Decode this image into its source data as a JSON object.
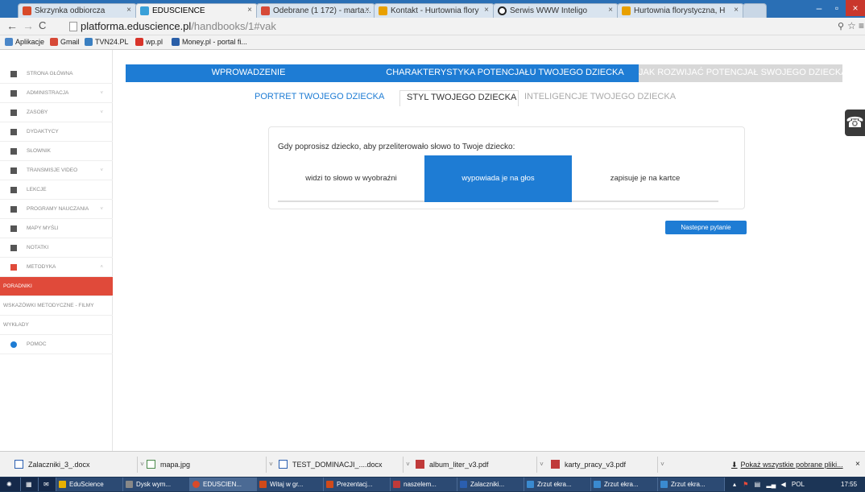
{
  "browser": {
    "tabs": [
      {
        "label": "Skrzynka odbiorcza",
        "color": "#d84a2a"
      },
      {
        "label": "EDUSCIENCE",
        "color": "#3aa0d8"
      },
      {
        "label": "Odebrane (1 172) - marta...",
        "color": "#d64937"
      },
      {
        "label": "Kontakt - Hurtownia flory",
        "color": "#e8a000"
      },
      {
        "label": "Serwis WWW Inteligo",
        "color": "#222222"
      },
      {
        "label": "Hurtownia florystyczna, H",
        "color": "#e8a000"
      }
    ],
    "active_tab_index": 1,
    "url_host": "platforma.eduscience.pl",
    "url_path": "/handbooks/1#vak",
    "bookmarks": [
      {
        "label": "Aplikacje",
        "color": "#4a86c8"
      },
      {
        "label": "Gmail",
        "color": "#d64937"
      },
      {
        "label": "TVN24.PL",
        "color": "#3a7fc1"
      },
      {
        "label": "wp.pl",
        "color": "#d8342a"
      },
      {
        "label": "Money.pl - portal fi...",
        "color": "#2a5fa8"
      }
    ]
  },
  "sidebar": {
    "items": [
      {
        "label": "STRONA GŁÓWNA",
        "chevron": false
      },
      {
        "label": "ADMINISTRACJA",
        "chevron": true
      },
      {
        "label": "ZASOBY",
        "chevron": true
      },
      {
        "label": "DYDAKTYCY",
        "chevron": false
      },
      {
        "label": "SŁOWNIK",
        "chevron": false
      },
      {
        "label": "TRANSMISJE VIDEO",
        "chevron": true
      },
      {
        "label": "LEKCJE",
        "chevron": false
      },
      {
        "label": "PROGRAMY NAUCZANIA",
        "chevron": true
      },
      {
        "label": "MAPY MYŚLI",
        "chevron": false
      },
      {
        "label": "NOTATKI",
        "chevron": false
      },
      {
        "label": "METODYKA",
        "chevron": true
      },
      {
        "label": "PORADNIKI",
        "chevron": false
      },
      {
        "label": "WSKAZÓWKI METODYCZNE - FILMY",
        "chevron": false
      },
      {
        "label": "WYKŁADY",
        "chevron": false
      },
      {
        "label": "POMOC",
        "chevron": false
      }
    ]
  },
  "main": {
    "top_nav": [
      {
        "label": "WPROWADZENIE"
      },
      {
        "label": "CHARAKTERYSTYKA POTENCJAŁU TWOJEGO DZIECKA"
      },
      {
        "label": "JAK ROZWIJAĆ POTENCJAŁ SWOJEGO DZIECKA?"
      }
    ],
    "sub_tabs": [
      {
        "label": "PORTRET TWOJEGO DZIECKA"
      },
      {
        "label": "STYL TWOJEGO DZIECKA"
      },
      {
        "label": "INTELIGENCJE TWOJEGO DZIECKA"
      }
    ],
    "active_sub_tab": 1,
    "question": "Gdy poprosisz dziecko, aby przeliterowało słowo to Twoje dziecko:",
    "answers": [
      {
        "label": "widzi to słowo w wyobraźni"
      },
      {
        "label": "wypowiada je na głos"
      },
      {
        "label": "zapisuje je na kartce"
      }
    ],
    "selected_answer": 1,
    "next_button": "Nastepne pytanie",
    "colors": {
      "primary": "#1e7cd4",
      "accent": "#e04a3a",
      "inactive": "#d8d8d8"
    }
  },
  "downloads": {
    "files": [
      {
        "name": "Zalaczniki_3_.docx",
        "type": "docx"
      },
      {
        "name": "mapa.jpg",
        "type": "jpg"
      },
      {
        "name": "TEST_DOMINACJI_....docx",
        "type": "docx"
      },
      {
        "name": "album_liter_v3.pdf",
        "type": "pdf"
      },
      {
        "name": "karty_pracy_v3.pdf",
        "type": "pdf"
      }
    ],
    "show_all": "Pokaż wszystkie pobrane pliki..."
  },
  "taskbar": {
    "items": [
      {
        "label": "EduScience",
        "color": "#e8b000"
      },
      {
        "label": "Dysk wym...",
        "color": "#888888"
      },
      {
        "label": "EDUSCIEN...",
        "color": "#d84a2a"
      },
      {
        "label": "Witaj w gr...",
        "color": "#d04a1a"
      },
      {
        "label": "Prezentacj...",
        "color": "#d04a1a"
      },
      {
        "label": "naszelem...",
        "color": "#c03a3a"
      },
      {
        "label": "Zalaczniki...",
        "color": "#2b5fb0"
      },
      {
        "label": "Zrzut ekra...",
        "color": "#3a8ad0"
      },
      {
        "label": "Zrzut ekra...",
        "color": "#3a8ad0"
      },
      {
        "label": "Zrzut ekra...",
        "color": "#3a8ad0"
      }
    ],
    "lang": "POL",
    "time": "17:55"
  }
}
